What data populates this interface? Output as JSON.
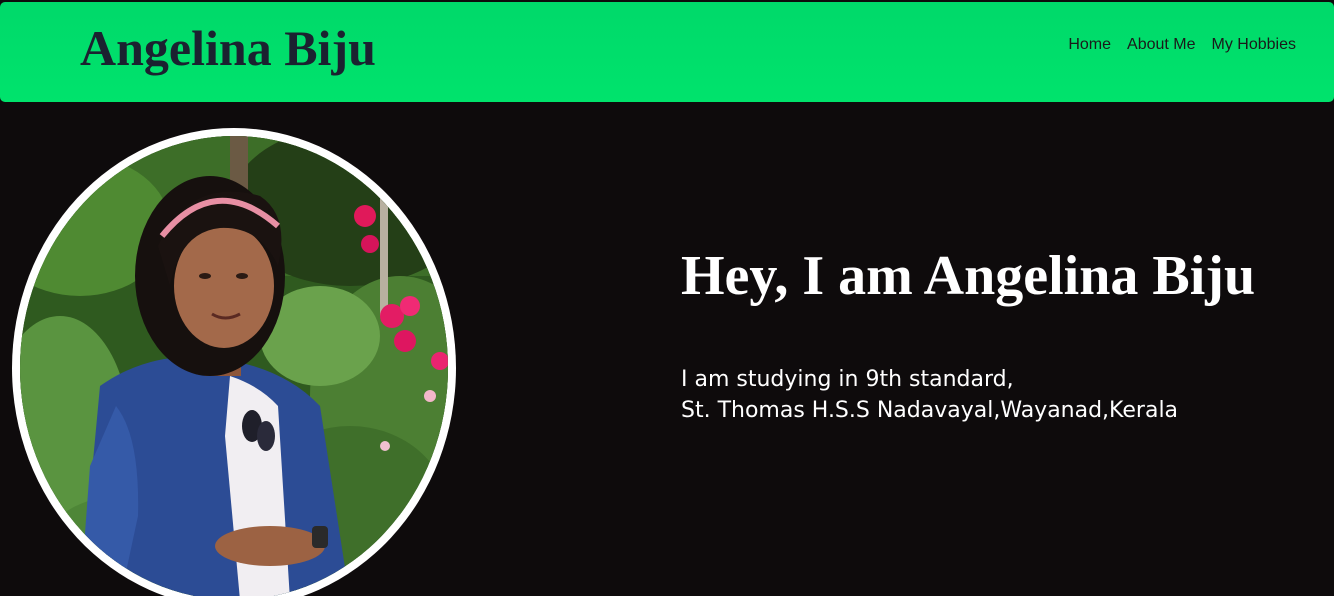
{
  "header": {
    "brand": "Angelina Biju",
    "nav": [
      {
        "label": "Home"
      },
      {
        "label": "About Me"
      },
      {
        "label": "My Hobbies"
      }
    ]
  },
  "hero": {
    "title": "Hey, I am Angelina Biju",
    "lines": [
      "I am studying in 9th standard,",
      "St. Thomas H.S.S Nadavayal,Wayanad,Kerala"
    ]
  },
  "profile_photo": {
    "description_icon": "portrait-photo"
  },
  "colors": {
    "navbar": "#00e36c",
    "background": "#0e0b0c",
    "brand_text": "#1b2230",
    "hero_text": "#ffffff"
  }
}
